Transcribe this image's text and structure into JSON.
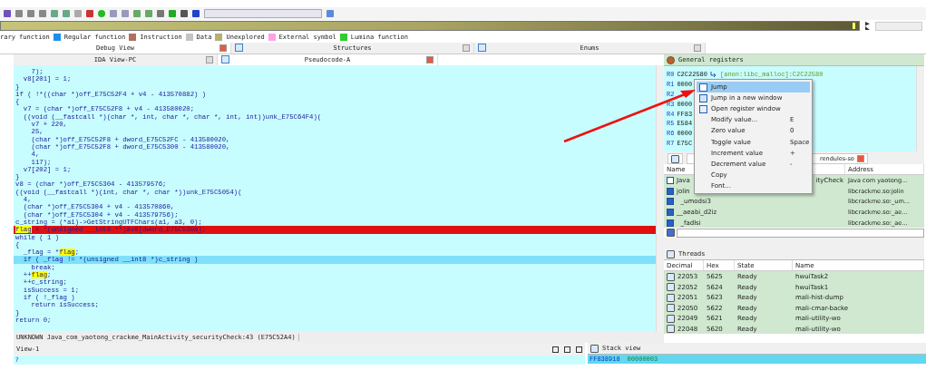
{
  "legend": [
    {
      "label": "rary function"
    },
    {
      "label": "Regular function",
      "color": "#1e8fe8"
    },
    {
      "label": "Instruction",
      "color": "#b0705a"
    },
    {
      "label": "Data",
      "color": "#c4c4c4"
    },
    {
      "label": "Unexplored",
      "color": "#b4b070"
    },
    {
      "label": "External symbol",
      "color": "#ffa0e8"
    },
    {
      "label": "Lumina function",
      "color": "#30cc30"
    }
  ],
  "top_tabs": [
    {
      "label": "Debug View",
      "selected": true
    },
    {
      "label": "Structures",
      "selected": false
    },
    {
      "label": "Enums",
      "selected": false
    }
  ],
  "editor_tabs": [
    {
      "label": "IDA View-PC",
      "selected": false
    },
    {
      "label": "Pseudocode-A",
      "selected": true
    }
  ],
  "code": {
    "lines": [
      {
        "text": "    7);",
        "breakpoint": false,
        "current": false
      },
      {
        "text": "  v8[201] = 1;",
        "breakpoint": false,
        "current": false
      },
      {
        "text": "}",
        "breakpoint": false,
        "current": false
      },
      {
        "text": "if ( !*((char *)off_E75C52F4 + v4 - 413570882) )",
        "breakpoint": false,
        "current": false
      },
      {
        "text": "{",
        "breakpoint": false,
        "current": false
      },
      {
        "text": "  v7 = (char *)off_E75C52F8 + v4 - 413580020;",
        "breakpoint": false,
        "current": false
      },
      {
        "text": "  ((void (__fastcall *)(char *, int, char *, char *, int, int))unk_E75C64F4)(",
        "breakpoint": false,
        "current": false
      },
      {
        "text": "    v7 + 220,",
        "breakpoint": false,
        "current": false
      },
      {
        "text": "    25,",
        "breakpoint": false,
        "current": false
      },
      {
        "text": "    (char *)off_E75C52F8 + dword_E75C52FC - 413580020,",
        "breakpoint": false,
        "current": false
      },
      {
        "text": "    (char *)off_E75C52F8 + dword_E75C5300 - 413580020,",
        "breakpoint": false,
        "current": false
      },
      {
        "text": "    4,",
        "breakpoint": false,
        "current": false
      },
      {
        "text": "    117);",
        "breakpoint": false,
        "current": false
      },
      {
        "text": "  v7[202] = 1;",
        "breakpoint": false,
        "current": false
      },
      {
        "text": "}",
        "breakpoint": false,
        "current": false
      },
      {
        "text": "v8 = (char *)off_E75C5304 - 413579576;",
        "breakpoint": false,
        "current": false
      },
      {
        "text": "((void (__fastcall *)(int, char *, char *))unk_E75C5054)(",
        "breakpoint": false,
        "current": false
      },
      {
        "text": "  4,",
        "breakpoint": false,
        "current": false
      },
      {
        "text": "  (char *)off_E75C5304 + v4 - 413570860,",
        "breakpoint": false,
        "current": false
      },
      {
        "text": "  (char *)off_E75C5304 + v4 - 413579756);",
        "breakpoint": false,
        "current": false
      },
      {
        "text": "c_string = (*a1)->GetStringUTFChars(a1, a3, 0);",
        "breakpoint": false,
        "current": false
      },
      {
        "segments": [
          {
            "text": "flag",
            "highlight": true
          },
          {
            "text": " = *(unsigned __int8 **)&v8[dword_E75C5308];",
            "highlight": false
          }
        ],
        "breakpoint": true,
        "current": false
      },
      {
        "text": "while ( 1 )",
        "breakpoint": false,
        "current": false
      },
      {
        "text": "{",
        "breakpoint": false,
        "current": false
      },
      {
        "segments": [
          {
            "text": "  _flag = *",
            "highlight": false
          },
          {
            "text": "flag",
            "highlight": true
          },
          {
            "text": ";",
            "highlight": false
          }
        ],
        "breakpoint": false,
        "current": false
      },
      {
        "text": "  if ( _flag != *(unsigned __int8 *)c_string )",
        "breakpoint": false,
        "current": true
      },
      {
        "text": "    break;",
        "breakpoint": false,
        "current": false
      },
      {
        "segments": [
          {
            "text": "  ++",
            "highlight": false
          },
          {
            "text": "flag",
            "highlight": true
          },
          {
            "text": ";",
            "highlight": false
          }
        ],
        "breakpoint": false,
        "current": false
      },
      {
        "text": "  ++c_string;",
        "breakpoint": false,
        "current": false
      },
      {
        "text": "  isSuccess = 1;",
        "breakpoint": false,
        "current": false
      },
      {
        "text": "  if ( !_flag )",
        "breakpoint": false,
        "current": false
      },
      {
        "text": "    return isSuccess;",
        "breakpoint": false,
        "current": false
      },
      {
        "text": "}",
        "breakpoint": false,
        "current": false
      },
      {
        "text": "return 0;",
        "breakpoint": false,
        "current": false
      }
    ]
  },
  "status_line": "UNKNOWN Java_com_yaotong_crackme_MainActivity_securityCheck:43 (E75C52A4)",
  "output": {
    "title": "View-1",
    "value": "?"
  },
  "stack_view": {
    "title": "Stack view",
    "rows": [
      {
        "address": "FF838918",
        "value": "00000003"
      }
    ]
  },
  "registers": {
    "title": "General registers",
    "rows": [
      {
        "name": "R0",
        "value": "C2C22580",
        "note": "[anon:libc_malloc]:C2C22580"
      },
      {
        "name": "R1",
        "value": "0000"
      },
      {
        "name": "R2"
      },
      {
        "name": "R3",
        "value": "0000"
      },
      {
        "name": "R4",
        "value": "FF83"
      },
      {
        "name": "R5",
        "value": "E584"
      },
      {
        "name": "R6",
        "value": "0000"
      },
      {
        "name": "R7",
        "value": "E75C"
      }
    ]
  },
  "context_menu": {
    "items": [
      {
        "label": "Jump",
        "kind": "jump",
        "selected": true
      },
      {
        "label": "Jump in a new window",
        "kind": "jump-window",
        "selected": false
      },
      {
        "label": "Open register window",
        "kind": "register-window",
        "selected": false
      },
      {
        "label": "Modify value...",
        "shortcut": "E",
        "kind": "plain",
        "selected": false
      },
      {
        "label": "Zero value",
        "shortcut": "0",
        "kind": "plain",
        "selected": false
      },
      {
        "label": "Toggle value",
        "shortcut": "Space",
        "kind": "plain",
        "selected": false
      },
      {
        "label": "Increment value",
        "shortcut": "+",
        "kind": "plain",
        "selected": false
      },
      {
        "label": "Decrement value",
        "shortcut": "-",
        "kind": "plain",
        "selected": false
      },
      {
        "label": "Copy",
        "kind": "plain",
        "selected": false
      },
      {
        "label": "Font...",
        "kind": "plain",
        "selected": false
      }
    ]
  },
  "modules": {
    "tab": "rendules-so",
    "columns": [
      "Name",
      "Address"
    ],
    "rows": [
      {
        "name_parts": [
          "Java",
          "ityCheck"
        ],
        "address": "Java com yaotong...",
        "kind": "function"
      },
      {
        "name": "jolin",
        "address": "libcrackme.so:jolin",
        "kind": "import"
      },
      {
        "name": "  _umodsi3",
        "address": "libcrackme.so:_um...",
        "kind": "import"
      },
      {
        "name": "__aeabi_d2iz",
        "address": "libcrackme.so:_ae...",
        "kind": "import"
      },
      {
        "name": "  _fadlsi",
        "address": "libcrackme.so:_ae...",
        "kind": "import"
      }
    ]
  },
  "threads": {
    "title": "Threads",
    "columns": [
      "Decimal",
      "Hex",
      "State",
      "Name"
    ],
    "rows": [
      {
        "decimal": "22053",
        "hex": "5625",
        "state": "Ready",
        "name": "hwuiTask2"
      },
      {
        "decimal": "22052",
        "hex": "5624",
        "state": "Ready",
        "name": "hwuiTask1"
      },
      {
        "decimal": "22051",
        "hex": "5623",
        "state": "Ready",
        "name": "mali-hist-dump"
      },
      {
        "decimal": "22050",
        "hex": "5622",
        "state": "Ready",
        "name": "mali-cmar-backe"
      },
      {
        "decimal": "22049",
        "hex": "5621",
        "state": "Ready",
        "name": "mali-utility-wo"
      },
      {
        "decimal": "22048",
        "hex": "5620",
        "state": "Ready",
        "name": "mali-utility-wo"
      }
    ]
  }
}
